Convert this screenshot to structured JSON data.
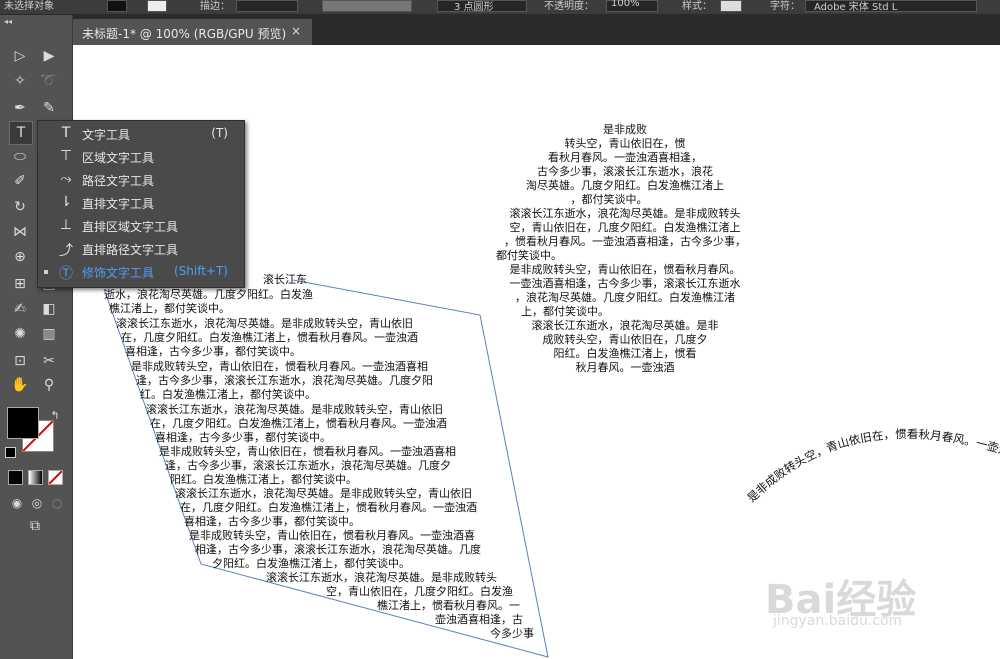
{
  "topbar": {
    "leftLabel": "未选择对象",
    "strokeLabel": "描边：",
    "brushLabel": "3 点圆形",
    "opacityLabel": "不透明度：",
    "opacityValue": "100%",
    "styleLabel": "样式：",
    "charLabel": "字符：",
    "fontName": "Adobe 宋体 Std L"
  },
  "tab": {
    "title": "未标题-1* @ 100% (RGB/GPU 预览)",
    "close": "×"
  },
  "toolbox": {
    "collapse": "◂◂"
  },
  "flyout": {
    "items": [
      {
        "label": "文字工具",
        "shortcut": "(T)",
        "icon": "type-icon"
      },
      {
        "label": "区域文字工具",
        "shortcut": "",
        "icon": "area-type-icon"
      },
      {
        "label": "路径文字工具",
        "shortcut": "",
        "icon": "type-on-path-icon"
      },
      {
        "label": "直排文字工具",
        "shortcut": "",
        "icon": "vertical-type-icon"
      },
      {
        "label": "直排区域文字工具",
        "shortcut": "",
        "icon": "vertical-area-type-icon"
      },
      {
        "label": "直排路径文字工具",
        "shortcut": "",
        "icon": "vertical-type-on-path-icon"
      },
      {
        "label": "修饰文字工具",
        "shortcut": "(Shift+T)",
        "icon": "touch-type-icon"
      }
    ],
    "accentColor": "#4e9ff5"
  },
  "circleText": {
    "lines": [
      "是非成败",
      "转头空，青山依旧在，惯",
      "看秋月春风。一壶浊酒喜相逢，",
      "古今多少事，滚滚长江东逝水，浪花",
      "淘尽英雄。几度夕阳红。白发渔樵江渚上",
      "，都付笑谈中。",
      "滚滚长江东逝水，浪花淘尽英雄。是非成败转头",
      "空，青山依旧在，几度夕阳红。白发渔樵江渚上",
      "，惯看秋月春风。一壶浊酒喜相逢，古今多少事，",
      "都付笑谈中。",
      "是非成败转头空，青山依旧在，惯看秋月春风。",
      "一壶浊酒喜相逢，古今多少事，滚滚长江东逝水",
      "，浪花淘尽英雄。几度夕阳红。白发渔樵江渚",
      "上，都付笑谈中。",
      "滚滚长江东逝水，浪花淘尽英雄。是非",
      "成败转头空，青山依旧在，几度夕",
      "阳红。白发渔樵江渚上，惯看",
      "秋月春风。一壶浊酒"
    ]
  },
  "areaText": {
    "lines": [
      "滚长江东",
      "逝水，浪花淘尽英雄。几度夕阳红。白发渔",
      "樵江渚上，都付笑谈中。",
      "滚滚长江东逝水，浪花淘尽英雄。是非成败转头空，青山依旧",
      "在，几度夕阳红。白发渔樵江渚上，惯看秋月春风。一壶浊酒",
      "喜相逢，古今多少事，都付笑谈中。",
      "是非成败转头空，青山依旧在，惯看秋月春风。一壶浊酒喜相",
      "逢，古今多少事，滚滚长江东逝水，浪花淘尽英雄。几度夕阳",
      "红。白发渔樵江渚上，都付笑谈中。",
      "滚滚长江东逝水，浪花淘尽英雄。是非成败转头空，青山依旧",
      "在，几度夕阳红。白发渔樵江渚上，惯看秋月春风。一壶浊酒",
      "喜相逢，古今多少事，都付笑谈中。",
      "是非成败转头空，青山依旧在，惯看秋月春风。一壶浊酒喜相",
      "逢，古今多少事，滚滚长江东逝水，浪花淘尽英雄。几度夕",
      "阳红。白发渔樵江渚上，都付笑谈中。",
      "滚滚长江东逝水，浪花淘尽英雄。是非成败转头空，青山依旧",
      "在，几度夕阳红。白发渔樵江渚上，惯看秋月春风。一壶浊酒",
      "喜相逢，古今多少事，都付笑谈中。",
      "是非成败转头空，青山依旧在，惯看秋月春风。一壶浊酒喜",
      "相逢，古今多少事，滚滚长江东逝水，浪花淘尽英雄。几度",
      "夕阳红。白发渔樵江渚上，都付笑谈中。",
      "滚滚长江东逝水，浪花淘尽英雄。是非成败转头",
      "空，青山依旧在，几度夕阳红。白发渔",
      "樵江渚上，惯看秋月春风。一",
      "壶浊酒喜相逢，古",
      "今多少事"
    ],
    "pathColor": "#5b7fc4"
  },
  "pathText": {
    "text": "是非成败转头空，青山依旧在，惯看秋月春风。一壶浊酒"
  },
  "watermark": {
    "brand": "Bai经验",
    "url": "jingyan.baidu.com"
  }
}
